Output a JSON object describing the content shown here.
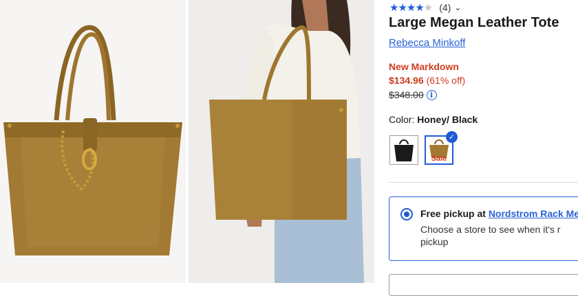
{
  "product": {
    "rating_count": "(4)",
    "rating_value": 4,
    "title": "Large Megan Leather Tote",
    "brand": "Rebecca Minkoff",
    "markdown_label": "New Markdown",
    "price": "$134.96",
    "discount": "(61% off)",
    "original_price": "$348.00",
    "color_label": "Color:",
    "color_value": "Honey/ Black",
    "swatches": [
      {
        "name": "Black",
        "color": "#1a1a1a"
      },
      {
        "name": "Honey/ Black",
        "color": "#a0782e",
        "badge": "Sale"
      }
    ]
  },
  "pickup": {
    "title_prefix": "Free pickup at",
    "store_link": "Nordstrom Rack Me",
    "description": "Choose a store to see when it's r pickup"
  },
  "colors": {
    "accent": "#1f5bd8",
    "sale": "#d03b1f",
    "suede": "#a0782e"
  },
  "icons": [
    "star-icon",
    "chevron-down-icon",
    "info-icon",
    "check-icon",
    "radio-selected-icon"
  ]
}
